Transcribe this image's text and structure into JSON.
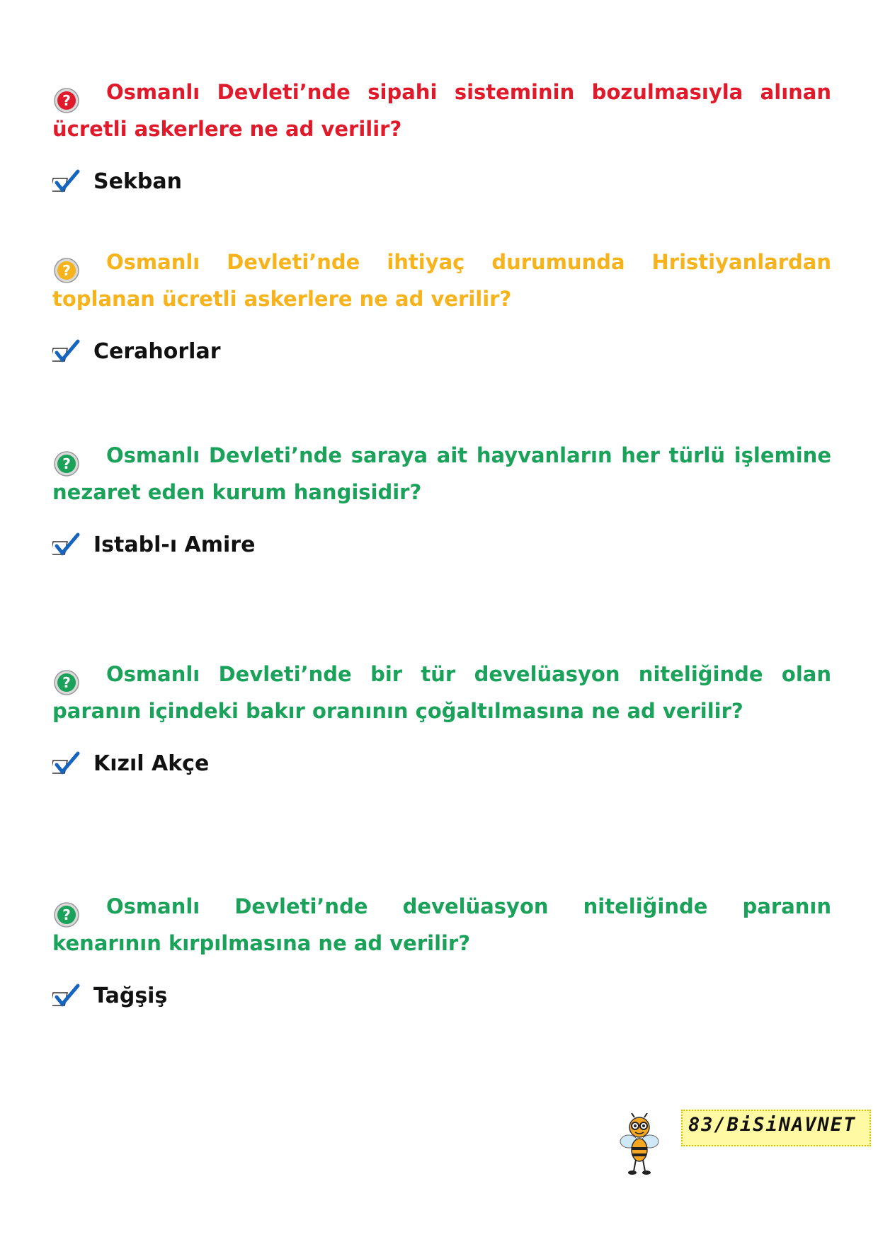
{
  "items": [
    {
      "question": "Osmanlı Devleti’nde sipahi sisteminin bozulmasıyla alınan ücretli askerlere ne ad verilir?",
      "answer": "Sekban",
      "color": "#e0192b",
      "icon": "red-question-icon"
    },
    {
      "question": "Osmanlı Devleti’nde ihtiyaç durumunda Hristiyanlardan toplanan ücretli askerlere ne ad verilir?",
      "answer": "Cerahorlar",
      "color": "#f6b31b",
      "icon": "orange-question-icon"
    },
    {
      "question": "Osmanlı Devleti’nde saraya ait hayvanların her türlü işlemine nezaret eden kurum hangisidir?",
      "answer": "Istabl-ı Amire",
      "color": "#1aa25a",
      "icon": "green-question-icon"
    },
    {
      "question": "Osmanlı Devleti’nde bir tür develüasyon niteliğinde olan paranın içindeki bakır oranının çoğaltılmasına ne ad verilir?",
      "answer": "Kızıl Akçe",
      "color": "#1aa25a",
      "icon": "green-question-icon"
    },
    {
      "question": "Osmanlı Devleti’nde develüasyon niteliğinde paranın kenarının kırpılmasına ne ad verilir?",
      "answer": "Tağşiş",
      "color": "#1aa25a",
      "icon": "green-question-icon"
    }
  ],
  "footer": {
    "page_label": "83/BiSiNAVNET",
    "badge_color": "#fff9a3",
    "mascot": "bee-mascot-icon"
  }
}
